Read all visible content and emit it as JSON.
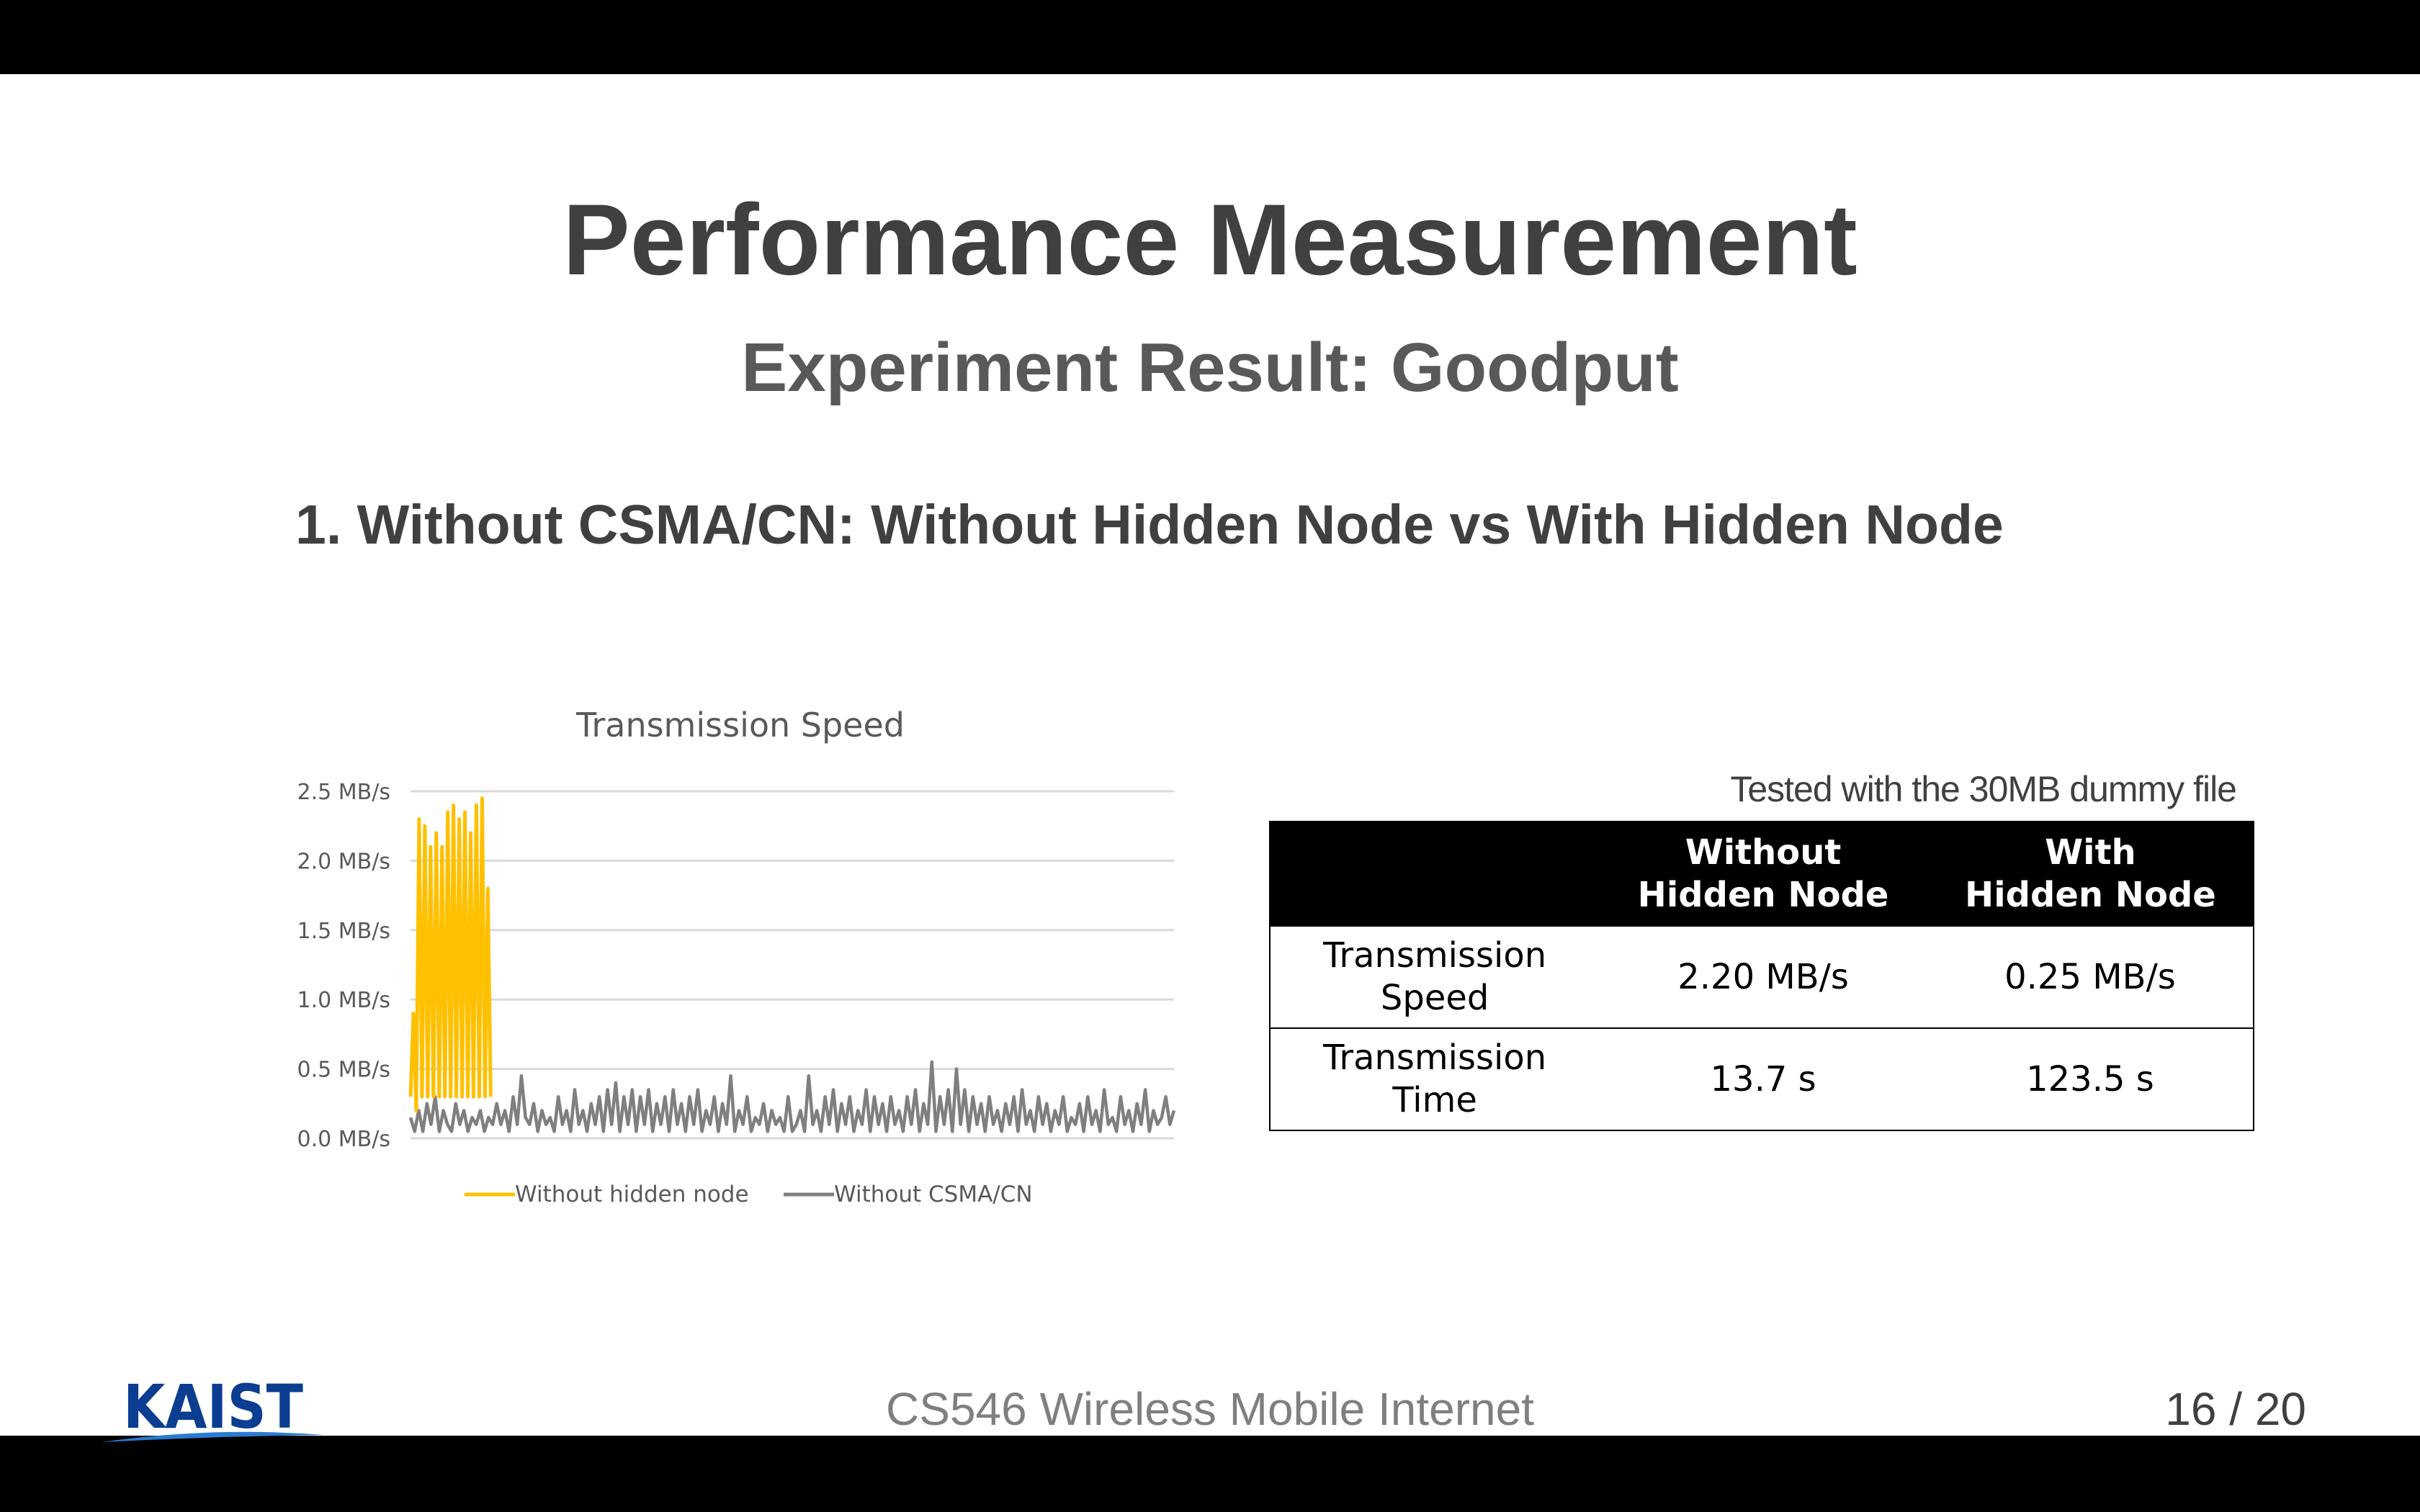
{
  "slide": {
    "title": "Performance Measurement",
    "subtitle": "Experiment Result: Goodput",
    "section_heading": "1. Without CSMA/CN: Without Hidden Node vs With Hidden Node",
    "note": "Tested with the 30MB dummy file",
    "footer": "CS546 Wireless Mobile Internet",
    "page_number": "16 / 20",
    "logo_text": "KAIST"
  },
  "table": {
    "headers": [
      "",
      "Without\nHidden Node",
      "With\nHidden Node"
    ],
    "rows": [
      [
        "Transmission\nSpeed",
        "2.20 MB/s",
        "0.25 MB/s"
      ],
      [
        "Transmission\nTime",
        "13.7 s",
        "123.5 s"
      ]
    ]
  },
  "colors": {
    "without_hidden_node": "#FFC000",
    "without_csma_cn": "#7F7F7F",
    "gridline": "#D9D9D9",
    "logo_blue": "#0B3D91"
  },
  "chart_data": {
    "type": "line",
    "title": "Transmission Speed",
    "xlabel": "",
    "ylabel": "",
    "ylim": [
      0,
      2.5
    ],
    "yticks": [
      "0.0 MB/s",
      "0.5 MB/s",
      "1.0 MB/s",
      "1.5 MB/s",
      "2.0 MB/s",
      "2.5 MB/s"
    ],
    "grid": true,
    "legend_position": "bottom",
    "series": [
      {
        "name": "Without hidden node",
        "color": "#FFC000",
        "values": [
          0.3,
          0.9,
          0.2,
          2.3,
          0.3,
          2.25,
          0.3,
          2.1,
          0.3,
          2.2,
          0.3,
          2.1,
          0.3,
          2.35,
          0.3,
          2.4,
          0.3,
          2.3,
          0.3,
          2.35,
          0.3,
          2.2,
          0.3,
          2.4,
          0.3,
          2.45,
          0.3,
          1.8,
          0.3
        ]
      },
      {
        "name": "Without CSMA/CN",
        "color": "#7F7F7F",
        "values": [
          0.15,
          0.05,
          0.2,
          0.05,
          0.25,
          0.1,
          0.3,
          0.05,
          0.2,
          0.1,
          0.05,
          0.25,
          0.1,
          0.2,
          0.05,
          0.15,
          0.1,
          0.2,
          0.05,
          0.15,
          0.1,
          0.25,
          0.1,
          0.2,
          0.05,
          0.3,
          0.1,
          0.45,
          0.15,
          0.1,
          0.25,
          0.05,
          0.2,
          0.1,
          0.15,
          0.05,
          0.3,
          0.1,
          0.2,
          0.05,
          0.35,
          0.1,
          0.2,
          0.05,
          0.25,
          0.1,
          0.3,
          0.05,
          0.35,
          0.1,
          0.4,
          0.05,
          0.3,
          0.1,
          0.35,
          0.05,
          0.3,
          0.1,
          0.35,
          0.05,
          0.25,
          0.1,
          0.3,
          0.05,
          0.35,
          0.1,
          0.25,
          0.05,
          0.3,
          0.1,
          0.35,
          0.05,
          0.2,
          0.1,
          0.3,
          0.05,
          0.25,
          0.1,
          0.45,
          0.05,
          0.2,
          0.1,
          0.3,
          0.05,
          0.15,
          0.1,
          0.25,
          0.05,
          0.2,
          0.1,
          0.15,
          0.05,
          0.3,
          0.05,
          0.1,
          0.2,
          0.05,
          0.45,
          0.1,
          0.2,
          0.05,
          0.3,
          0.1,
          0.35,
          0.05,
          0.25,
          0.1,
          0.3,
          0.05,
          0.2,
          0.1,
          0.35,
          0.05,
          0.3,
          0.1,
          0.25,
          0.05,
          0.3,
          0.1,
          0.2,
          0.05,
          0.3,
          0.1,
          0.35,
          0.05,
          0.25,
          0.1,
          0.55,
          0.05,
          0.3,
          0.1,
          0.35,
          0.05,
          0.5,
          0.1,
          0.35,
          0.05,
          0.3,
          0.1,
          0.25,
          0.05,
          0.3,
          0.1,
          0.2,
          0.05,
          0.25,
          0.1,
          0.3,
          0.05,
          0.35,
          0.1,
          0.2,
          0.05,
          0.3,
          0.1,
          0.25,
          0.05,
          0.2,
          0.1,
          0.3,
          0.05,
          0.15,
          0.1,
          0.25,
          0.05,
          0.3,
          0.1,
          0.2,
          0.05,
          0.35,
          0.1,
          0.15,
          0.05,
          0.3,
          0.1,
          0.2,
          0.05,
          0.25,
          0.1,
          0.35,
          0.05,
          0.2,
          0.1,
          0.15,
          0.3,
          0.1,
          0.2
        ]
      }
    ]
  }
}
